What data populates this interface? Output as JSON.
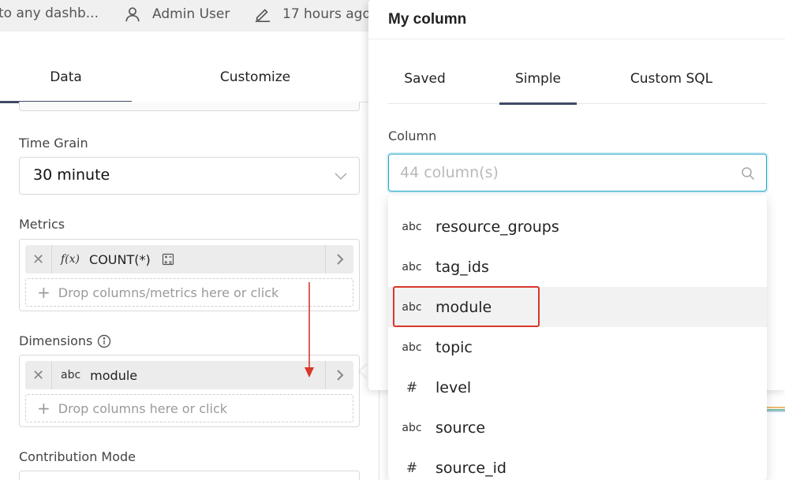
{
  "topbar": {
    "breadcrumb": "to any dashb...",
    "owner": "Admin User",
    "modified": "17 hours ago"
  },
  "left_tabs": [
    {
      "label": "Data",
      "active": true
    },
    {
      "label": "Customize",
      "active": false
    }
  ],
  "time_grain": {
    "label": "Time Grain",
    "value": "30 minute"
  },
  "metrics": {
    "label": "Metrics",
    "item": {
      "type": "f(x)",
      "name": "COUNT(*)"
    },
    "drop_hint": "Drop columns/metrics here or click"
  },
  "dimensions": {
    "label": "Dimensions",
    "item": {
      "type": "abc",
      "name": "module"
    },
    "drop_hint": "Drop columns here or click"
  },
  "contribution": {
    "label": "Contribution Mode"
  },
  "popover": {
    "title": "My column",
    "tabs": [
      {
        "label": "Saved",
        "active": false
      },
      {
        "label": "Simple",
        "active": true
      },
      {
        "label": "Custom SQL",
        "active": false
      }
    ],
    "column_label": "Column",
    "search_placeholder": "44 column(s)",
    "options": [
      {
        "type": "abc",
        "name": "resource_groups"
      },
      {
        "type": "abc",
        "name": "tag_ids"
      },
      {
        "type": "abc",
        "name": "module",
        "highlighted": true
      },
      {
        "type": "abc",
        "name": "topic"
      },
      {
        "type": "#",
        "name": "level"
      },
      {
        "type": "abc",
        "name": "source"
      },
      {
        "type": "#",
        "name": "source_id"
      }
    ]
  },
  "colors": {
    "accent": "#20a7c9",
    "tab_indicator": "#3f4a66",
    "annotation_red": "#d9372b"
  }
}
